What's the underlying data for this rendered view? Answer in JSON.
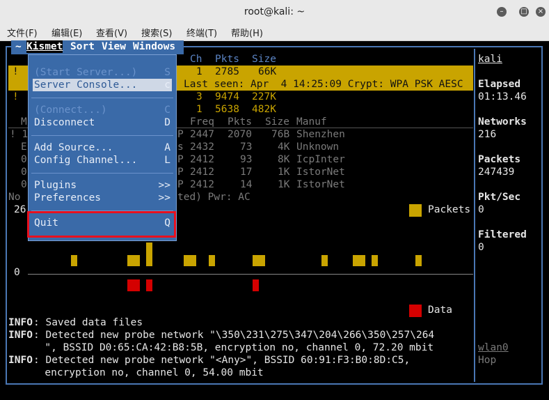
{
  "window": {
    "title": "root@kali: ~",
    "menu": [
      "文件(F)",
      "编辑(E)",
      "查看(V)",
      "搜索(S)",
      "终端(T)",
      "帮助(H)"
    ]
  },
  "kismet": {
    "menubar": [
      "Kismet",
      "Sort",
      "View",
      "Windows"
    ],
    "menubar_prefix": "~",
    "dropdown": [
      {
        "label": "(Start Server...)",
        "key": "S",
        "disabled": true
      },
      {
        "label": "Server Console...",
        "key": "c",
        "disabled": false,
        "selected": true
      },
      {
        "label": "(Connect...)",
        "key": "C",
        "disabled": true
      },
      {
        "label": "Disconnect",
        "key": "D",
        "disabled": false
      },
      {
        "label": "Add Source...",
        "key": "A",
        "disabled": false
      },
      {
        "label": "Config Channel...",
        "key": "L",
        "disabled": false
      },
      {
        "label": "Plugins",
        "key": ">>",
        "disabled": false
      },
      {
        "label": "Preferences",
        "key": ">>",
        "disabled": false
      },
      {
        "label": "Quit",
        "key": "Q",
        "disabled": false
      }
    ],
    "network_header": {
      "ch": "Ch",
      "pkts": "Pkts",
      "size": "Size"
    },
    "network_rows": [
      {
        "mark": "!",
        "ch": "1",
        "pkts": "2785",
        "size": "66K",
        "highlight": true,
        "detail": "Last seen: Apr  4 14:25:09 Crypt: WPA PSK AESC"
      },
      {
        "mark": "!",
        "ch": "3",
        "pkts": "9474",
        "size": "227K"
      },
      {
        "mark": "",
        "ch": "1",
        "pkts": "5638",
        "size": "482K"
      }
    ],
    "client_header": {
      "m": "M",
      "freq": "Freq",
      "pkts": "Pkts",
      "size": "Size",
      "manuf": "Manuf"
    },
    "client_rows": [
      {
        "a": "! 1",
        "b": "P",
        "freq": "2447",
        "pkts": "2070",
        "size": "76B",
        "manuf": "Shenzhen"
      },
      {
        "a": "E",
        "b": "s",
        "freq": "2432",
        "pkts": "73",
        "size": "4K",
        "manuf": "Unknown"
      },
      {
        "a": "0",
        "b": "P",
        "freq": "2412",
        "pkts": "93",
        "size": "8K",
        "manuf": "IcpInter"
      },
      {
        "a": "0",
        "b": "P",
        "freq": "2412",
        "pkts": "17",
        "size": "1K",
        "manuf": "IstorNet"
      },
      {
        "a": "0",
        "b": "P",
        "freq": "2412",
        "pkts": "14",
        "size": "1K",
        "manuf": "IstorNet"
      }
    ],
    "client_footer": "No",
    "client_footer_tail": "ted) Pwr: AC",
    "graph": {
      "ymax_label": "26",
      "zero_label": "0",
      "packets_legend": "Packets",
      "data_legend": "Data",
      "packets_color": "#c9a400",
      "data_color": "#d40000"
    },
    "sidebar": {
      "host": "kali",
      "elapsed_label": "Elapsed",
      "elapsed_value": "01:13.46",
      "networks_label": "Networks",
      "networks_value": "216",
      "packets_label": "Packets",
      "packets_value": "247439",
      "pktsec_label": "Pkt/Sec",
      "pktsec_value": "0",
      "filtered_label": "Filtered",
      "filtered_value": "0",
      "iface": "wlan0",
      "iface_state": "Hop"
    },
    "log": [
      {
        "tag": "INFO",
        "text": ": Saved data files"
      },
      {
        "tag": "INFO",
        "text": ": Detected new probe network \"\\350\\231\\275\\347\\204\\266\\350\\257\\264"
      },
      {
        "tag": "",
        "text": "      \", BSSID D0:65:CA:42:B8:5B, encryption no, channel 0, 72.20 mbit"
      },
      {
        "tag": "INFO",
        "text": ": Detected new probe network \"<Any>\", BSSID 60:91:F3:B0:8D:C5,"
      },
      {
        "tag": "",
        "text": "      encryption no, channel 0, 54.00 mbit"
      }
    ]
  }
}
